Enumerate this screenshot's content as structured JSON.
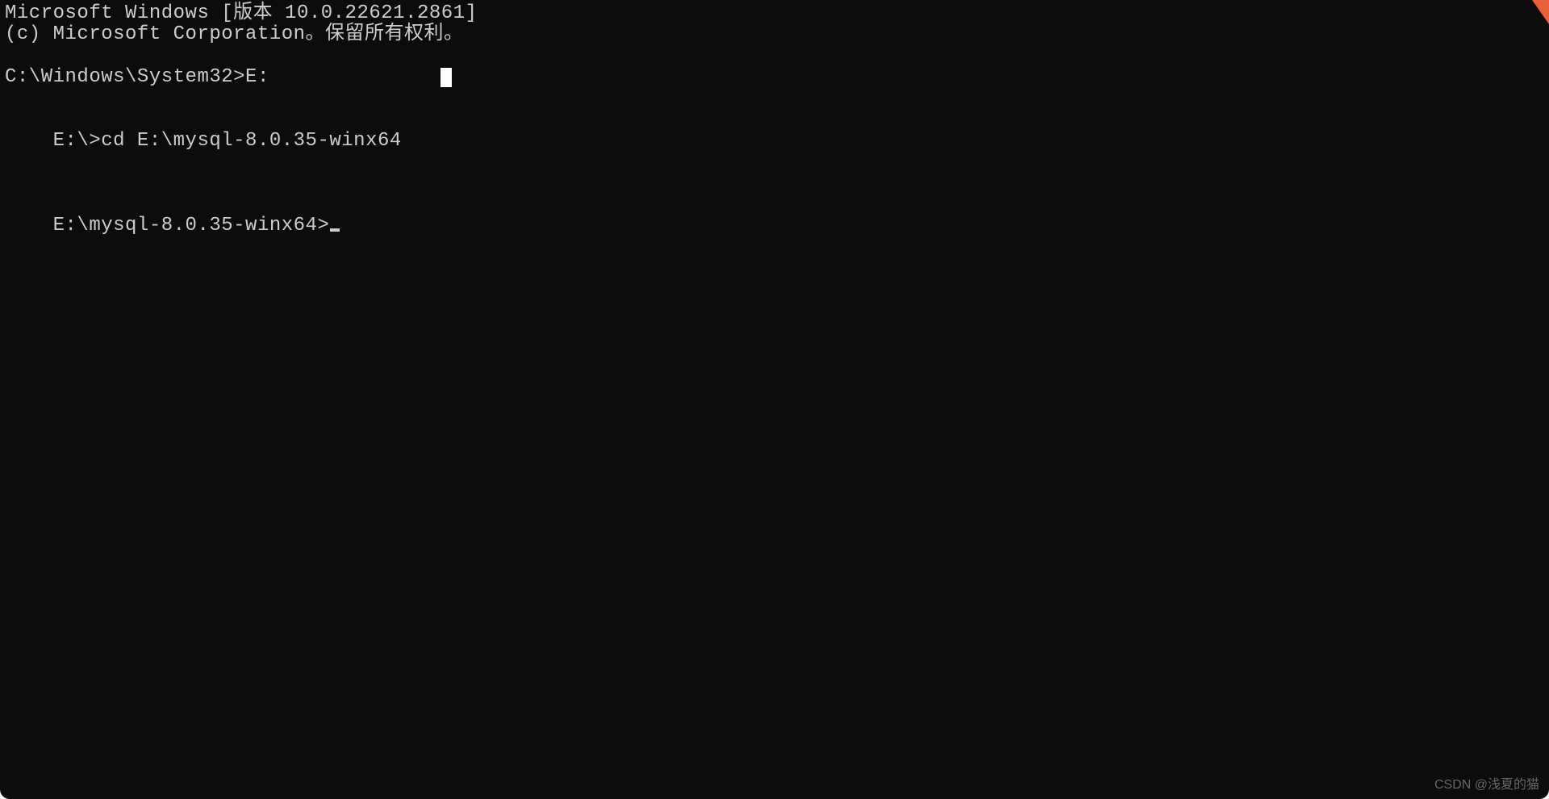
{
  "terminal": {
    "header_line1": "Microsoft Windows [版本 10.0.22621.2861]",
    "header_line2": "(c) Microsoft Corporation。保留所有权利。",
    "blank1": "",
    "prompt1_prefix": "C:\\Windows\\System32>",
    "prompt1_cmd": "E:",
    "blank2": "",
    "prompt2_prefix": "E:\\>",
    "prompt2_cmd": "cd E:\\mysql-8.0.35-winx64",
    "blank3": "",
    "prompt3_prefix": "E:\\mysql-8.0.35-winx64>",
    "prompt3_cmd": ""
  },
  "watermark": "CSDN @浅夏的猫"
}
